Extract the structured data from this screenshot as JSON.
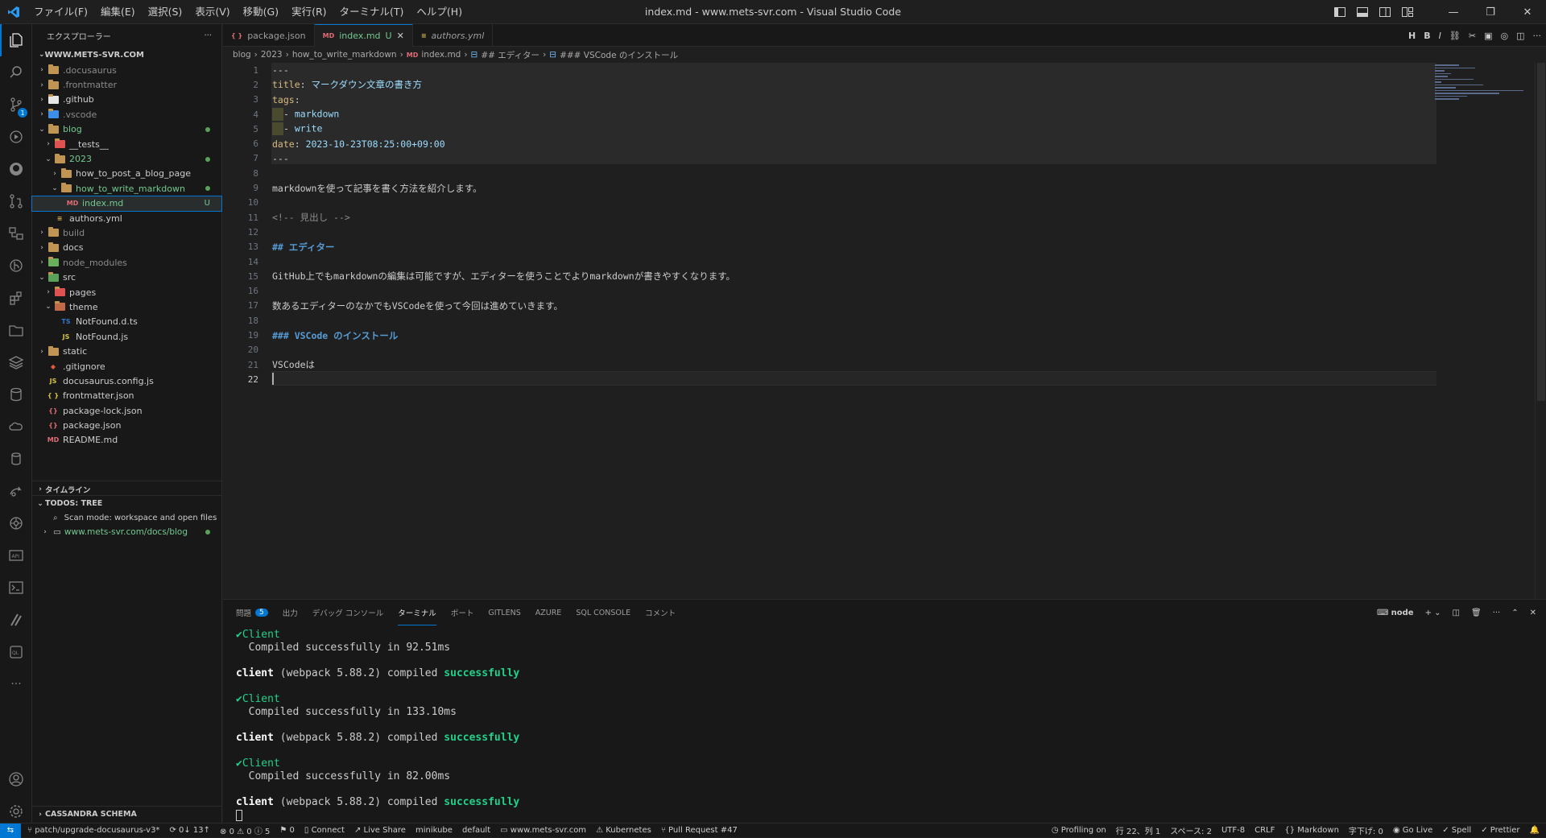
{
  "window": {
    "title": "index.md - www.mets-svr.com - Visual Studio Code",
    "menu": [
      "ファイル(F)",
      "編集(E)",
      "選択(S)",
      "表示(V)",
      "移動(G)",
      "実行(R)",
      "ターミナル(T)",
      "ヘルプ(H)"
    ]
  },
  "activity": {
    "scm_badge": "1"
  },
  "sidebar": {
    "title": "エクスプローラー",
    "more": "···",
    "root": "WWW.METS-SVR.COM",
    "items": [
      {
        "label": ".docusaurus",
        "color": "dim"
      },
      {
        "label": ".frontmatter",
        "color": "dim"
      },
      {
        "label": ".github",
        "color": ""
      },
      {
        "label": ".vscode",
        "color": "dim"
      },
      {
        "label": "blog",
        "color": "green"
      },
      {
        "label": "__tests__",
        "color": ""
      },
      {
        "label": "2023",
        "color": "green"
      },
      {
        "label": "how_to_post_a_blog_page",
        "color": ""
      },
      {
        "label": "how_to_write_markdown",
        "color": "green"
      },
      {
        "label": "index.md",
        "color": "green",
        "flag": "U"
      },
      {
        "label": "authors.yml",
        "color": ""
      },
      {
        "label": "build",
        "color": "dim"
      },
      {
        "label": "docs",
        "color": ""
      },
      {
        "label": "node_modules",
        "color": "dim"
      },
      {
        "label": "src",
        "color": ""
      },
      {
        "label": "pages",
        "color": ""
      },
      {
        "label": "theme",
        "color": ""
      },
      {
        "label": "NotFound.d.ts",
        "color": ""
      },
      {
        "label": "NotFound.js",
        "color": ""
      },
      {
        "label": "static",
        "color": ""
      },
      {
        "label": ".gitignore",
        "color": ""
      },
      {
        "label": "docusaurus.config.js",
        "color": ""
      },
      {
        "label": "frontmatter.json",
        "color": ""
      },
      {
        "label": "package-lock.json",
        "color": ""
      },
      {
        "label": "package.json",
        "color": ""
      },
      {
        "label": "README.md",
        "color": ""
      }
    ],
    "timeline": "タイムライン",
    "todos": "TODOS: TREE",
    "scan_mode": "Scan mode: workspace and open files",
    "todos_path": "www.mets-svr.com/docs/blog",
    "cassandra": "CASSANDRA SCHEMA"
  },
  "tabs": [
    {
      "label": "package.json",
      "icon": "{}",
      "active": false
    },
    {
      "label": "index.md",
      "modified": "U",
      "icon": "MD",
      "active": true
    },
    {
      "label": "authors.yml",
      "icon": "YML",
      "active": false
    }
  ],
  "breadcrumb": [
    "blog",
    "2023",
    "how_to_write_markdown",
    "index.md",
    "## エディター",
    "### VSCode のインストール"
  ],
  "editor": {
    "lines": [
      "---",
      "title: マークダウン文章の書き方",
      "tags:",
      "  - markdown",
      "  - write",
      "date: 2023-10-23T08:25:00+09:00",
      "---",
      "",
      "markdownを使って記事を書く方法を紹介します。",
      "",
      "<!-- 見出し -->",
      "",
      "## エディター",
      "",
      "GitHub上でもmarkdownの編集は可能ですが、エディターを使うことでよりmarkdownが書きやすくなります。",
      "",
      "数あるエディターのなかでもVSCodeを使って今回は進めていきます。",
      "",
      "### VSCode のインストール",
      "",
      "VSCodeは",
      ""
    ],
    "current_line": 22
  },
  "panel": {
    "tabs": [
      "問題",
      "出力",
      "デバッグ コンソール",
      "ターミナル",
      "ポート",
      "GITLENS",
      "AZURE",
      "SQL CONSOLE",
      "コメント"
    ],
    "problems_count": "5",
    "terminal_name": "node",
    "terminal": [
      {
        "check": "✔",
        "text": "Client"
      },
      {
        "text": "  Compiled successfully in 92.51ms"
      },
      {
        "text": ""
      },
      {
        "bold": "client",
        "mid": " (webpack 5.88.2) compiled ",
        "ok": "successfully"
      },
      {
        "text": ""
      },
      {
        "check": "✔",
        "text": "Client"
      },
      {
        "text": "  Compiled successfully in 133.10ms"
      },
      {
        "text": ""
      },
      {
        "bold": "client",
        "mid": " (webpack 5.88.2) compiled ",
        "ok": "successfully"
      },
      {
        "text": ""
      },
      {
        "check": "✔",
        "text": "Client"
      },
      {
        "text": "  Compiled successfully in 82.00ms"
      },
      {
        "text": ""
      },
      {
        "bold": "client",
        "mid": " (webpack 5.88.2) compiled ",
        "ok": "successfully"
      }
    ]
  },
  "status": {
    "branch": "patch/upgrade-docusaurus-v3*",
    "sync": "0↓ 13↑",
    "problems": "⊗ 0 ⚠ 0 ⓘ 5",
    "ports": "0",
    "connect": "Connect",
    "liveshare": "Live Share",
    "minikube": "minikube",
    "default": "default",
    "host": "www.mets-svr.com",
    "kubernetes": "Kubernetes",
    "pr": "Pull Request #47",
    "profiling": "Profiling on",
    "position": "行 22、列 1",
    "spaces": "スペース: 2",
    "encoding": "UTF-8",
    "eol": "CRLF",
    "language": "Markdown",
    "chars": "字下げ: 0",
    "golive": "Go Live",
    "spell": "Spell",
    "prettier": "Prettier"
  }
}
